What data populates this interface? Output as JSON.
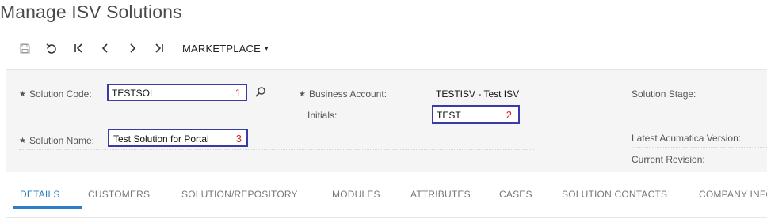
{
  "page": {
    "title": "Manage ISV Solutions"
  },
  "toolbar": {
    "buttons": [
      {
        "icon": "save-icon"
      },
      {
        "icon": "undo-icon"
      },
      {
        "icon": "first-record-icon"
      },
      {
        "icon": "previous-record-icon"
      },
      {
        "icon": "next-record-icon"
      },
      {
        "icon": "last-record-icon"
      }
    ],
    "menu_label": "MARKETPLACE",
    "menu_caret": "▾"
  },
  "form": {
    "required_marker": "★",
    "solution_code": {
      "label": "Solution Code:",
      "value": "TESTSOL",
      "marker": "1"
    },
    "business_account": {
      "label": "Business Account:",
      "value": "TESTISV - Test ISV"
    },
    "initials": {
      "label": "Initials:",
      "value": "TEST",
      "marker": "2"
    },
    "solution_stage": {
      "label": "Solution Stage:",
      "value": ""
    },
    "solution_name": {
      "label": "Solution Name:",
      "value": "Test Solution for Portal",
      "marker": "3"
    },
    "latest_acumatica_version": {
      "label": "Latest Acumatica Version:",
      "value": ""
    },
    "current_revision": {
      "label": "Current Revision:",
      "value": ""
    }
  },
  "tabs": [
    {
      "label": "DETAILS",
      "active": true
    },
    {
      "label": "CUSTOMERS",
      "active": false
    },
    {
      "label": "SOLUTION/REPOSITORY",
      "active": false
    },
    {
      "label": "MODULES",
      "active": false
    },
    {
      "label": "ATTRIBUTES",
      "active": false
    },
    {
      "label": "CASES",
      "active": false
    },
    {
      "label": "SOLUTION CONTACTS",
      "active": false
    },
    {
      "label": "COMPANY INFO",
      "active": false
    }
  ],
  "colors": {
    "accent": "#2b7fc4",
    "highlight_border": "#3a3aa8",
    "marker_red": "#d9232e",
    "panel_bg": "#f5f5f5"
  }
}
